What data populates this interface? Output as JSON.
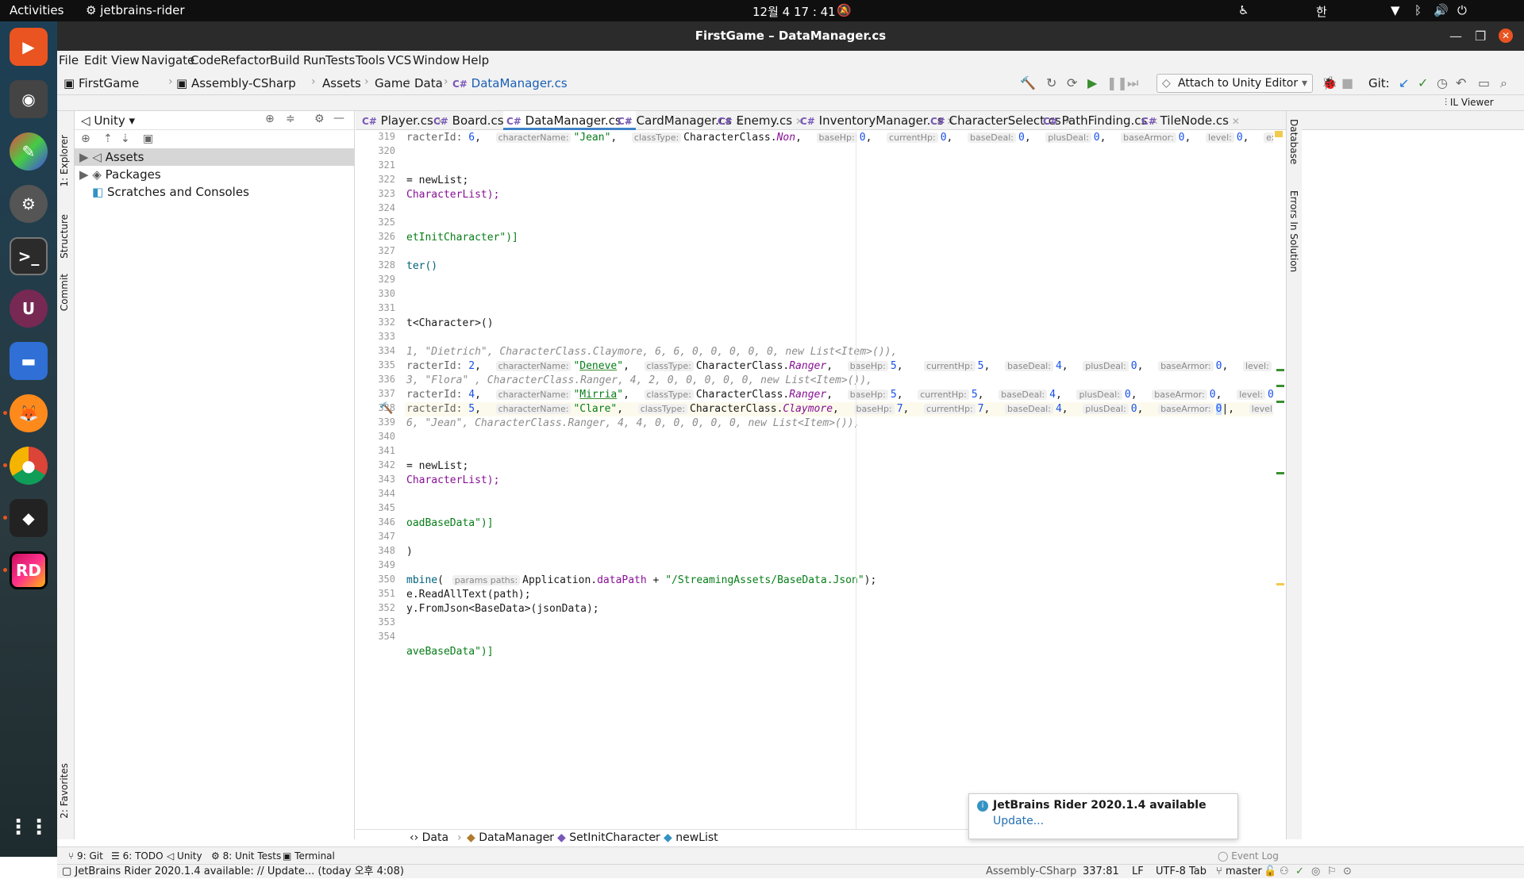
{
  "topbar": {
    "activities": "Activities",
    "app": "jetbrains-rider",
    "clock": "12월 4  17 : 41",
    "ime": "한"
  },
  "window": {
    "title": "FirstGame – DataManager.cs"
  },
  "menu": [
    "File",
    "Edit",
    "View",
    "Navigate",
    "Code",
    "Refactor",
    "Build",
    "Run",
    "Tests",
    "Tools",
    "VCS",
    "Window",
    "Help"
  ],
  "breadcrumb": [
    "FirstGame",
    "Assembly-CSharp",
    "Assets",
    "Game",
    "Data",
    "DataManager.cs"
  ],
  "toolbar": {
    "attach": "Attach to Unity Editor",
    "git": "Git:",
    "il_viewer": "IL Viewer"
  },
  "left_tabs": {
    "explorer": "1: Explorer",
    "structure": "Structure",
    "commit": "Commit",
    "favorites": "2: Favorites"
  },
  "right_tabs": {
    "database": "Database",
    "errors": "Errors In Solution"
  },
  "explorer": {
    "mode": "Unity",
    "items": [
      "Assets",
      "Packages",
      "Scratches and Consoles"
    ]
  },
  "tabs": [
    "Player.cs",
    "Board.cs",
    "DataManager.cs",
    "CardManager.cs",
    "Enemy.cs",
    "InventoryManager.cs",
    "CharacterSelect.cs",
    "PathFinding.cs",
    "TileNode.cs"
  ],
  "active_tab": "DataManager.cs",
  "code": {
    "lines": [
      319,
      320,
      321,
      322,
      323,
      324,
      325,
      326,
      327,
      328,
      329,
      330,
      331,
      332,
      333,
      334,
      335,
      336,
      337,
      338,
      339,
      340,
      341,
      342,
      343,
      344,
      345,
      346,
      347,
      348,
      349,
      350,
      351,
      352,
      353,
      354
    ],
    "c322": "= newList;",
    "c323": "CharacterList);",
    "c326": "etInitCharacter\")]",
    "c327": "ter()",
    "c331": "t<Character>()",
    "c333": "1, \"Dietrich\", CharacterClass.Claymore, 6, 6, 0, 0, 0, 0, 0, new List<Item>()),",
    "c335": "3, \"Flora\" , CharacterClass.Ranger, 4, 2, 0, 0, 0, 0, 0, new List<Item>()),",
    "c338": "6, \"Jean\", CharacterClass.Ranger, 4, 4, 0, 0, 0, 0, 0, new List<Item>()),",
    "c341": "= newList;",
    "c342": "CharacterList);",
    "c345": "oadBaseData\")]",
    "c346": ")",
    "c349": "e.ReadAllText(path);",
    "c350": "y.FromJson<BaseData>(jsonData);",
    "c353": "aveBaseData\")]"
  },
  "bottom_crumbs": [
    "Data",
    "DataManager",
    "SetInitCharacter",
    "newList"
  ],
  "tool_windows": [
    "9: Git",
    "6: TODO",
    "Unity",
    "8: Unit Tests",
    "Terminal",
    "Event Log"
  ],
  "status": {
    "message": "JetBrains Rider 2020.1.4 available: // Update... (today 오후 4:08)",
    "assembly": "Assembly-CSharp",
    "position": "337:81",
    "eol": "LF",
    "encoding": "UTF-8",
    "indent": "Tab",
    "branch": "master"
  },
  "notification": {
    "title": "JetBrains Rider 2020.1.4 available",
    "link": "Update..."
  }
}
